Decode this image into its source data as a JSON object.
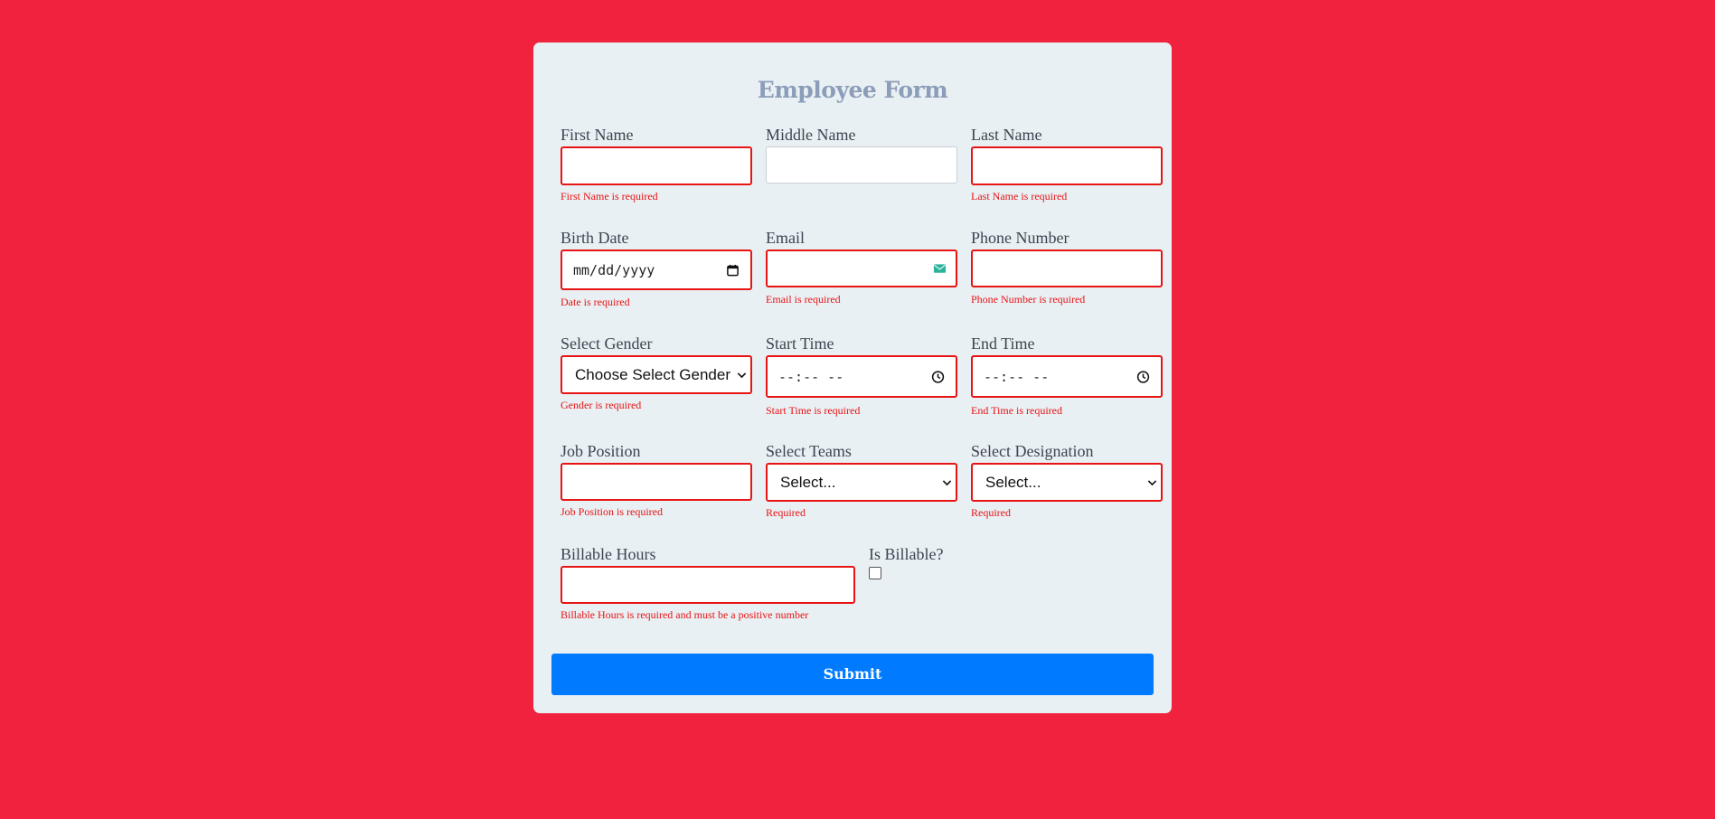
{
  "form": {
    "title": "Employee Form",
    "submit_label": "Submit",
    "colors": {
      "background": "#f0223d",
      "card": "#e9f0f4",
      "title": "#8b9db8",
      "error": "#e81313",
      "submit": "#007bff"
    },
    "fields": {
      "first_name": {
        "label": "First Name",
        "value": "",
        "error": "First Name is required"
      },
      "middle_name": {
        "label": "Middle Name",
        "value": ""
      },
      "last_name": {
        "label": "Last Name",
        "value": "",
        "error": "Last Name is required"
      },
      "birth_date": {
        "label": "Birth Date",
        "placeholder": "mm/dd/yyyy",
        "error": "Date is required",
        "icon": "calendar-icon"
      },
      "email": {
        "label": "Email",
        "value": "",
        "error": "Email is required",
        "icon": "envelope-icon"
      },
      "phone": {
        "label": "Phone Number",
        "value": "",
        "error": "Phone Number is required"
      },
      "gender": {
        "label": "Select Gender",
        "selected": "Choose Select Gender",
        "error": "Gender is required",
        "icon": "chevron-down-icon"
      },
      "start_time": {
        "label": "Start Time",
        "placeholder": "--:-- --",
        "error": "Start Time is required",
        "icon": "clock-icon"
      },
      "end_time": {
        "label": "End Time",
        "placeholder": "--:-- --",
        "error": "End Time is required",
        "icon": "clock-icon"
      },
      "job_position": {
        "label": "Job Position",
        "value": "",
        "error": "Job Position is required"
      },
      "teams": {
        "label": "Select Teams",
        "selected": "Select...",
        "error": "Required",
        "icon": "chevron-down-icon"
      },
      "designation": {
        "label": "Select Designation",
        "selected": "Select...",
        "error": "Required",
        "icon": "chevron-down-icon"
      },
      "billable_hours": {
        "label": "Billable Hours",
        "value": "",
        "error": "Billable Hours is required and must be a positive number"
      },
      "is_billable": {
        "label": "Is Billable?",
        "checked": false
      }
    }
  }
}
